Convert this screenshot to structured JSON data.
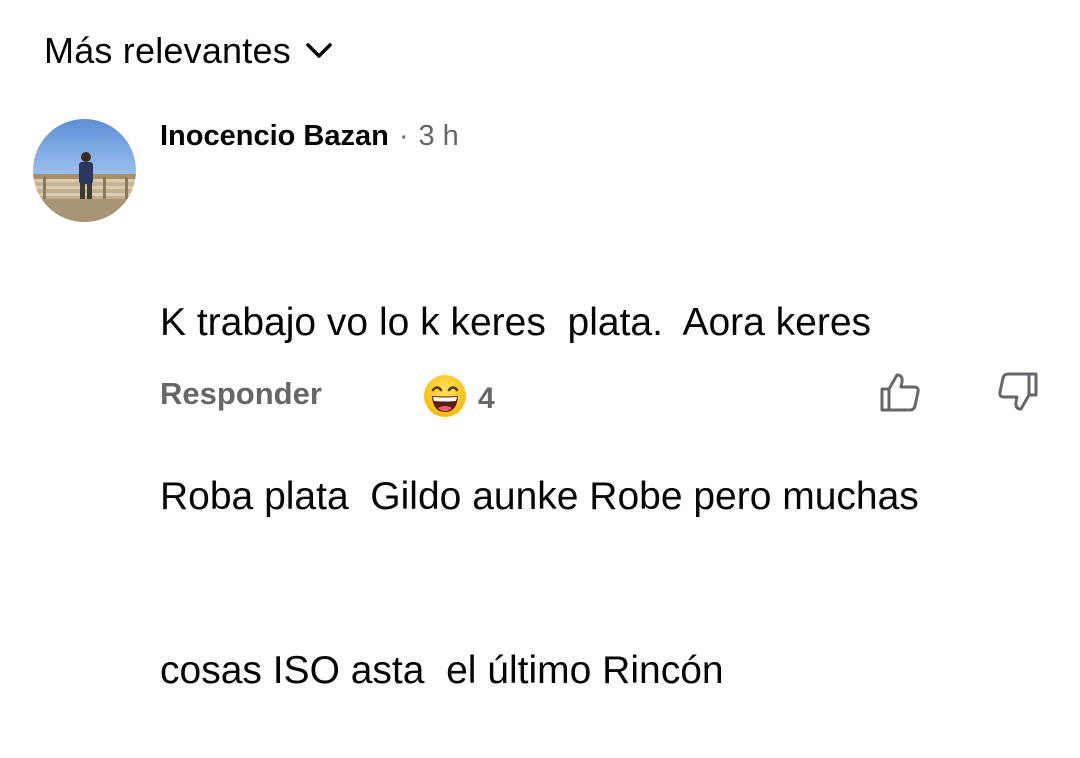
{
  "sort": {
    "label": "Más relevantes",
    "icon": "chevron-down-icon"
  },
  "comment": {
    "author": "Inocencio Bazan",
    "separator": "·",
    "time": "3 h",
    "lines": [
      "K trabajo vo lo k keres  plata.  Aora keres",
      "Roba plata  Gildo aunke Robe pero muchas",
      "cosas ISO asta  el último Rincón"
    ],
    "actions": {
      "reply_label": "Responder",
      "reaction_icon": "laughing-emoji-icon",
      "reaction_count": "4",
      "like_icon": "thumbs-up-icon",
      "dislike_icon": "thumbs-down-icon"
    }
  }
}
